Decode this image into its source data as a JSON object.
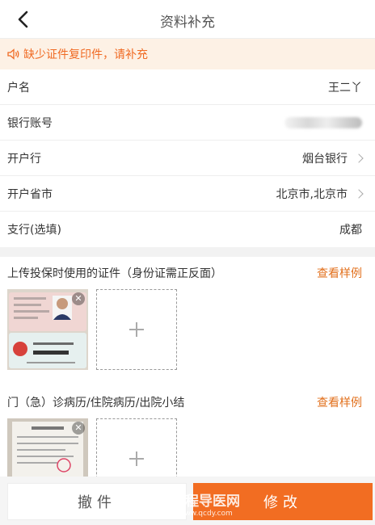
{
  "nav": {
    "title": "资料补充"
  },
  "notice": {
    "text": "缺少证件复印件，请补充",
    "color": "#f06a23"
  },
  "form": {
    "rows": [
      {
        "label": "户名",
        "value": "王二丫",
        "chevron": false
      },
      {
        "label": "银行账号",
        "value": "",
        "chevron": false,
        "blurred": true
      },
      {
        "label": "开户行",
        "value": "烟台银行",
        "chevron": true
      },
      {
        "label": "开户省市",
        "value": "北京市,北京市",
        "chevron": true
      },
      {
        "label": "支行(选填)",
        "value": "成都",
        "chevron": false
      }
    ]
  },
  "sections": [
    {
      "title": "上传投保时使用的证件（身份证需正反面）",
      "link": "查看样例"
    },
    {
      "title": "门（急）诊病历/住院病历/出院小结",
      "link": "查看样例"
    }
  ],
  "buttons": {
    "cancel": "撤件",
    "edit": "修改"
  },
  "watermark": {
    "title": "全程导医网",
    "url": "www.qcdy.com"
  },
  "colors": {
    "accent": "#f26d22",
    "link": "#e2701d",
    "notice_bg": "#fdf1e5"
  }
}
